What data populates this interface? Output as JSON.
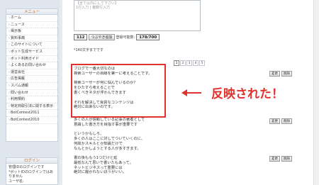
{
  "sidebar": {
    "menu_title": "メニュー",
    "menu_items": [
      "ホーム",
      "ニュース",
      "掲示板",
      "質料事典",
      "このサイトについて",
      "ボット生成サービス",
      "ボット利用ガイド",
      "よくあるお問い合わせ",
      "運営会社",
      "広告掲載",
      "スパム通報",
      "問い合わせ",
      "利用規約",
      "特定商取引法に関する表示",
      "BotContest2011",
      "BotContest2010"
    ],
    "login_title": "ログイン",
    "login_lines": [
      "管理IDのログインです",
      "*ボットIDのログインではありません",
      "ユーザ名:"
    ]
  },
  "form": {
    "textarea_lines": [
      "【全て以内にして下さい】",
      "1行入力 | 複数行入力"
    ],
    "char_count": "112",
    "add_button": "つぶやき追加",
    "available_label": "登録可能数:",
    "available_value": "178/700",
    "limit_note": "*140文字までです"
  },
  "pager": {
    "pages": [
      "1",
      "2",
      "3",
      "4",
      "5"
    ],
    "current": "1"
  },
  "posts": [
    {
      "lines": [
        "ブログで一番大切なのは",
        "検索ユーザーの目線を第一に考えることです。",
        "",
        "検索ユーザーが何に悩んでいるのか？",
        "をひたすら考えることで",
        "書くべきネタが浮かんできます",
        "",
        "それを解決して良質なコンテンツは",
        "絶対に出来ないのです。"
      ],
      "edit": "変更",
      "delete": "削除"
    },
    {
      "lines": [
        "多くの人が信頼している記事の著者として",
        "意識した書き方を目指す事が重要です",
        "",
        "というかもしろ、",
        "多くの人はここに対してついていくのに、",
        "何故かスキルとか知識だけで",
        "なんとかしようとする人が多すぎます。"
      ],
      "edit": "変更",
      "delete": "削除"
    },
    {
      "lines": [
        "書の後ももう1つだけと延",
        "最低なんて思いで書いたもあって。",
        "ネットビジネスって重要には",
        "絶対に履かれないほうがいい。"
      ],
      "edit": "変更",
      "delete": "削除"
    }
  ],
  "annotation": {
    "text": "反映された！",
    "color": "#e0322d"
  }
}
